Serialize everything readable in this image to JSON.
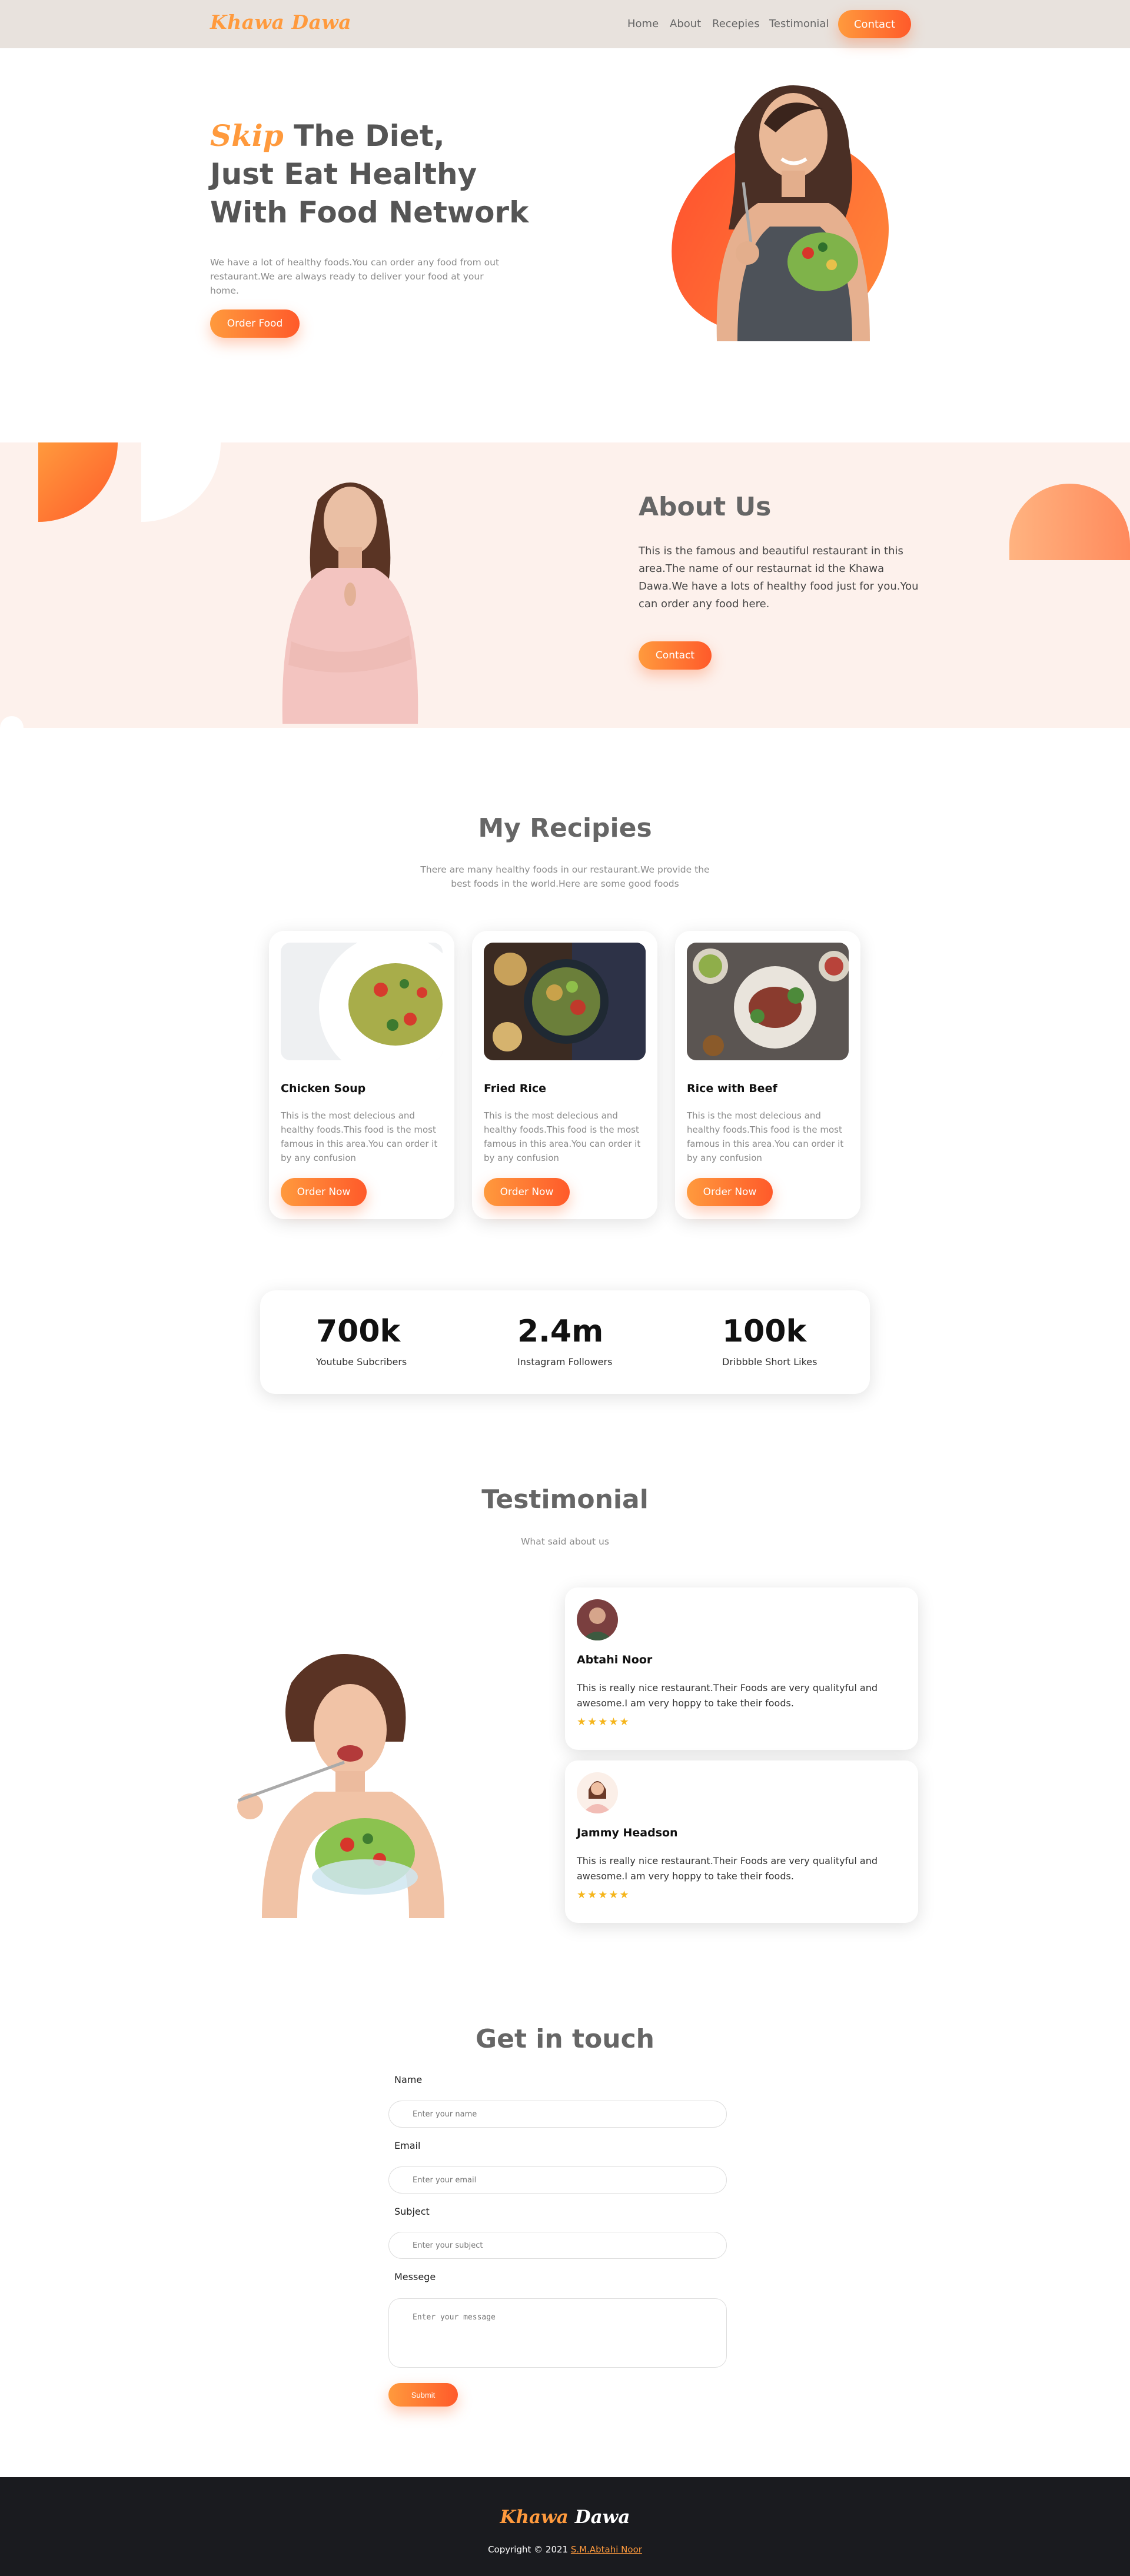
{
  "header": {
    "logo": "Khawa Dawa",
    "nav": [
      "Home",
      "About",
      "Recepies",
      "Testimonial"
    ],
    "contact": "Contact"
  },
  "hero": {
    "title_accent": "Skip",
    "title_line1_rest": " The Diet,",
    "title_line2": "Just Eat Healthy",
    "title_line3": "With Food Network",
    "description": "We have a lot of healthy foods.You can order any food from out restaurant.We are always ready to deliver your food at your home.",
    "button": "Order Food"
  },
  "about": {
    "title": "About Us",
    "description": "This is the famous and beautiful restaurant in this area.The name of our restaurnat id the Khawa Dawa.We have a lots of healthy food just for you.You can order any food here.",
    "button": "Contact"
  },
  "recipes": {
    "title": "My Recipies",
    "subtitle": "There are many healthy foods in our restaurant.We provide the best foods in the world.Here are some good foods",
    "cards": [
      {
        "title": "Chicken Soup",
        "description": "This is the most delecious and healthy foods.This food is the most famous in this area.You can order it by any confusion",
        "button": "Order Now"
      },
      {
        "title": "Fried Rice",
        "description": "This is the most delecious and healthy foods.This food is the most famous in this area.You can order it by any confusion",
        "button": "Order Now"
      },
      {
        "title": "Rice with Beef",
        "description": "This is the most delecious and healthy foods.This food is the most famous in this area.You can order it by any confusion",
        "button": "Order Now"
      }
    ]
  },
  "stats": [
    {
      "value": "700k",
      "label": "Youtube Subcribers"
    },
    {
      "value": "2.4m",
      "label": "Instagram Followers"
    },
    {
      "value": "100k",
      "label": "Dribbble Short Likes"
    }
  ],
  "testimonial": {
    "title": "Testimonial",
    "subtitle": "What said about us",
    "reviews": [
      {
        "name": "Abtahi Noor",
        "text": "This is really nice restaurant.Their Foods are very qualityful and awesome.I am very hoppy to take their foods.",
        "stars": "★★★★★"
      },
      {
        "name": "Jammy Headson",
        "text": "This is really nice restaurant.Their Foods are very qualityful and awesome.I am very hoppy to take their foods.",
        "stars": "★★★★★"
      }
    ]
  },
  "contact_form": {
    "title": "Get in touch",
    "name_label": "Name",
    "name_placeholder": "Enter your name",
    "email_label": "Email",
    "email_placeholder": "Enter your email",
    "subject_label": "Subject",
    "subject_placeholder": "Enter your subject",
    "message_label": "Messege",
    "message_placeholder": "Enter your message",
    "submit": "Submit"
  },
  "footer": {
    "logo_part1": "Khawa",
    "logo_part2": "Dawa",
    "copyright": "Copyright © 2021",
    "author": "S.M.Abtahi Noor"
  },
  "colors": {
    "accent": "#ff9a3d",
    "accent_dark": "#ff5a2a",
    "about_bg": "#fdf1ec",
    "header_bg": "#e8e2dd",
    "footer_bg": "#1a1b1f",
    "star": "#f5b51b"
  }
}
